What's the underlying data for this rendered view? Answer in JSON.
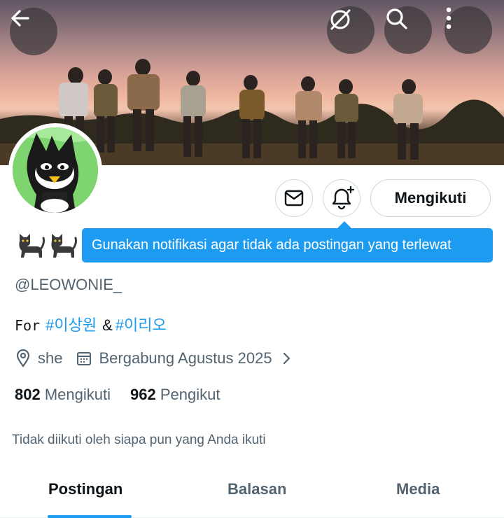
{
  "header": {
    "back_icon": "arrow-left-icon",
    "icons": [
      "grok-icon",
      "search-icon",
      "more-vertical-icon"
    ]
  },
  "profile": {
    "emoji": "🐈‍⬛🐈‍⬛",
    "handle": "@LEOWONIE_",
    "bio_prefix": "For",
    "bio_tag1": "#이상원",
    "bio_amp": "&",
    "bio_tag2": "#이리오",
    "location": "she",
    "joined": "Bergabung Agustus 2025",
    "following_count": "802",
    "following_label": "Mengikuti",
    "followers_count": "962",
    "followers_label": "Pengikut",
    "followed_by_note": "Tidak diikuti oleh siapa pun yang Anda ikuti"
  },
  "actions": {
    "follow_label": "Mengikuti",
    "tooltip": "Gunakan notifikasi agar tidak ada postingan yang terlewat"
  },
  "tabs": [
    {
      "label": "Postingan",
      "active": true
    },
    {
      "label": "Balasan",
      "active": false
    },
    {
      "label": "Media",
      "active": false
    }
  ],
  "colors": {
    "accent": "#1d9bf0",
    "secondary_text": "#536471",
    "primary_text": "#0f1419"
  }
}
